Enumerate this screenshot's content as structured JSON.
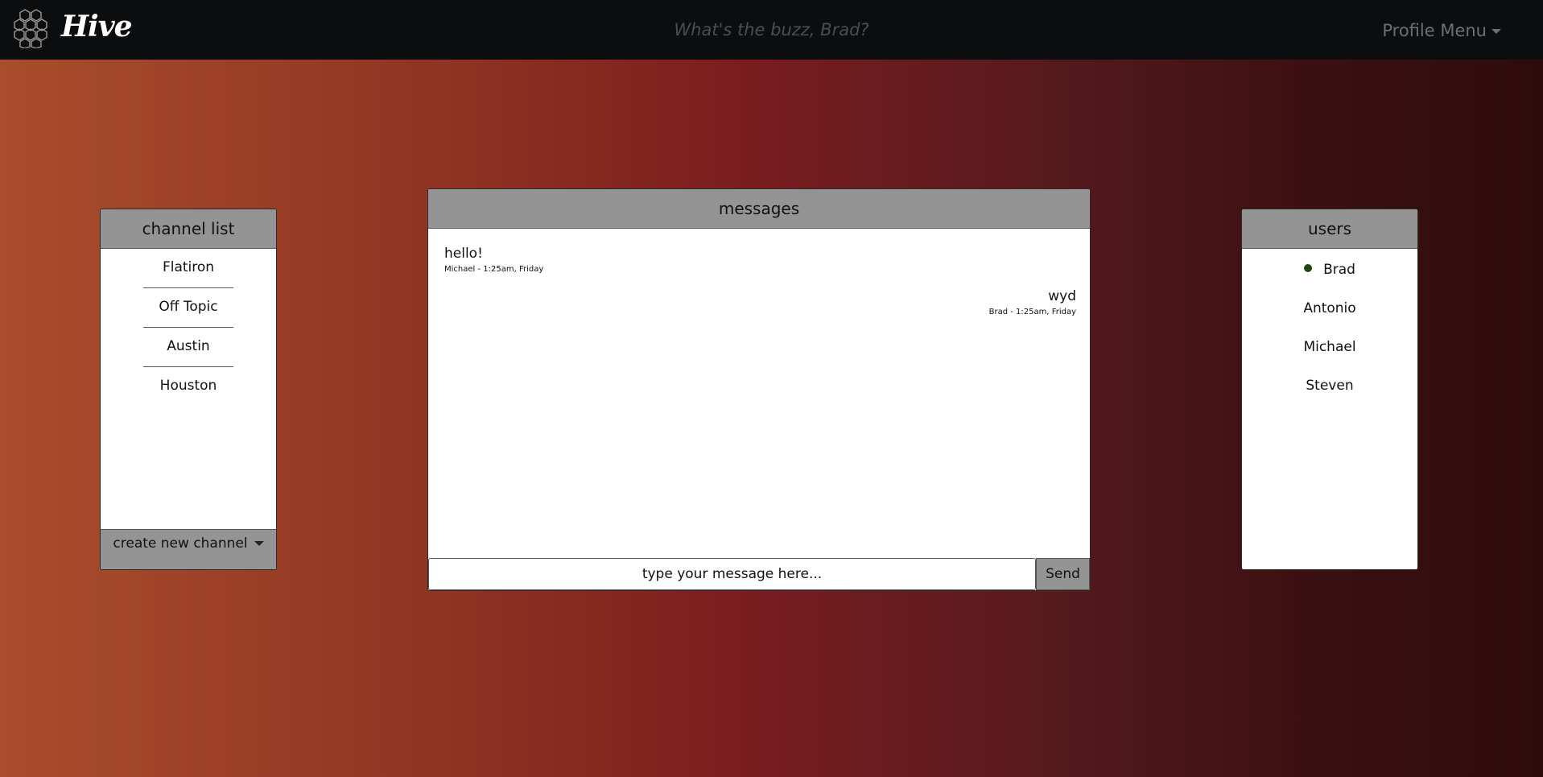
{
  "navbar": {
    "brand": "Hive",
    "tagline": "What's the buzz, Brad?",
    "profile_menu": "Profile Menu"
  },
  "channels": {
    "title": "channel list",
    "items": [
      {
        "label": "Flatiron"
      },
      {
        "label": "Off Topic"
      },
      {
        "label": "Austin"
      },
      {
        "label": "Houston"
      }
    ],
    "create_label": "create new channel"
  },
  "messages": {
    "title": "messages",
    "list": [
      {
        "text": "hello!",
        "meta": "Michael - 1:25am, Friday",
        "side": "left"
      },
      {
        "text": "wyd",
        "meta": "Brad - 1:25am, Friday",
        "side": "right"
      }
    ],
    "input_placeholder": "type your message here...",
    "send_label": "Send"
  },
  "users": {
    "title": "users",
    "items": [
      {
        "name": "Brad",
        "online": true
      },
      {
        "name": "Antonio",
        "online": false
      },
      {
        "name": "Michael",
        "online": false
      },
      {
        "name": "Steven",
        "online": false
      }
    ],
    "online_color": "#1c4a10"
  },
  "colors": {
    "navbar_bg": "#0c0d0f",
    "panel_header": "#949494"
  }
}
